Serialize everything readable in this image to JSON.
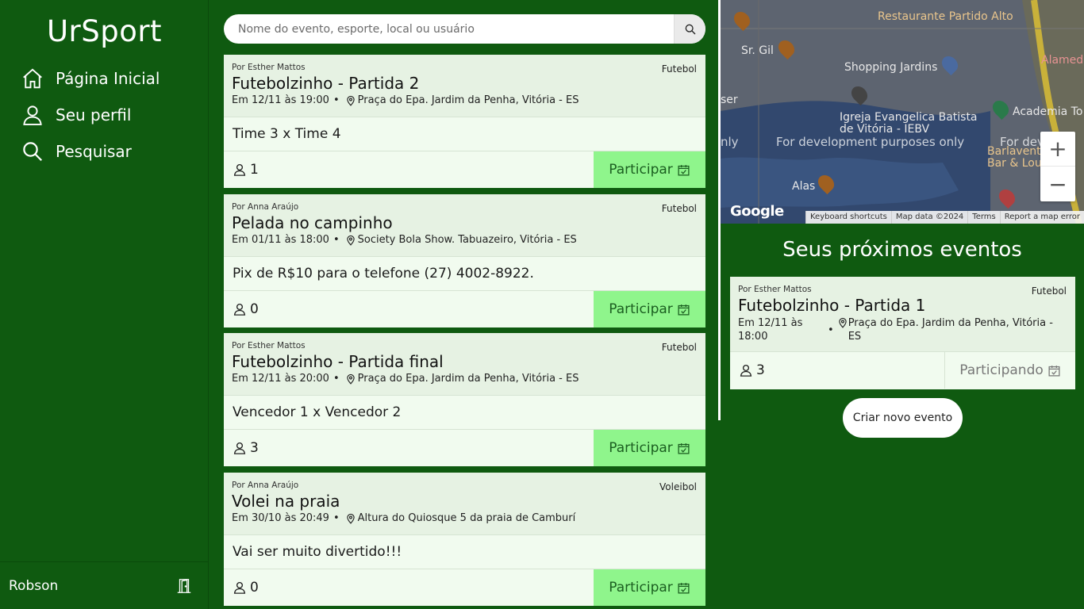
{
  "app": {
    "brand": "UrSport"
  },
  "nav": [
    {
      "label": "Página Inicial",
      "icon": "home-icon"
    },
    {
      "label": "Seu perfil",
      "icon": "user-icon"
    },
    {
      "label": "Pesquisar",
      "icon": "search-icon"
    }
  ],
  "user": {
    "name": "Robson",
    "logout_icon": "door-exit-icon"
  },
  "search": {
    "placeholder": "Nome do evento, esporte, local ou usuário"
  },
  "feed": [
    {
      "author": "Por Esther Mattos",
      "sport": "Futebol",
      "title": "Futebolzinho - Partida 2",
      "date": "Em 12/11 às 19:00",
      "location": "Praça do Epa. Jardim da Penha, Vitória - ES",
      "description": "Time 3 x Time 4",
      "participants": "1",
      "action": "Participar"
    },
    {
      "author": "Por Anna Araújo",
      "sport": "Futebol",
      "title": "Pelada no campinho",
      "date": "Em 01/11 às 18:00",
      "location": "Society Bola Show. Tabuazeiro, Vitória - ES",
      "description": "Pix de R$10 para o telefone (27) 4002-8922.",
      "participants": "0",
      "action": "Participar"
    },
    {
      "author": "Por Esther Mattos",
      "sport": "Futebol",
      "title": "Futebolzinho - Partida final",
      "date": "Em 12/11 às 20:00",
      "location": "Praça do Epa. Jardim da Penha, Vitória - ES",
      "description": "Vencedor 1 x Vencedor 2",
      "participants": "3",
      "action": "Participar"
    },
    {
      "author": "Por Anna Araújo",
      "sport": "Voleibol",
      "title": "Volei na praia",
      "date": "Em 30/10 às 20:49",
      "location": "Altura do Quiosque 5 da praia de Camburí",
      "description": "Vai ser muito divertido!!!",
      "participants": "0",
      "action": "Participar"
    }
  ],
  "map": {
    "labels": [
      "Restaurante Partido Alto",
      "Sr. Gil",
      "Shopping Jardins",
      "Alamed",
      "Igreja Evangelica Batista",
      "de Vitória - IEBV",
      "Academia To",
      "Barlavento Be",
      "Bar & Lou",
      "Alas",
      "ser",
      "nly",
      "For dev"
    ],
    "dev_notice": "For development purposes only",
    "logo": "Google",
    "zoom_in": "+",
    "zoom_out": "−",
    "footer": [
      "Keyboard shortcuts",
      "Map data ©2024",
      "Terms",
      "Report a map error"
    ]
  },
  "upcoming": {
    "title": "Seus próximos eventos",
    "event": {
      "author": "Por Esther Mattos",
      "sport": "Futebol",
      "title": "Futebolzinho - Partida 1",
      "date": "Em 12/11 às 18:00",
      "separator": "•",
      "location": "Praça do Epa. Jardim da Penha, Vitória - ES",
      "participants": "3",
      "status": "Participando"
    },
    "create_label": "Criar novo evento"
  },
  "separator": "•"
}
